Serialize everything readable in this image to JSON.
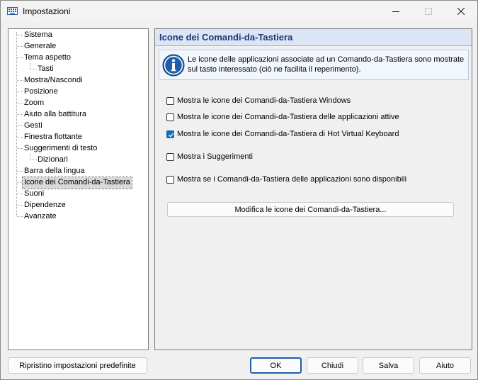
{
  "window": {
    "title": "Impostazioni",
    "icon": "keyboard-icon"
  },
  "tree": {
    "items": [
      {
        "label": "Sistema"
      },
      {
        "label": "Generale"
      },
      {
        "label": "Tema aspetto"
      },
      {
        "label": "Tasti"
      },
      {
        "label": "Mostra/Nascondi"
      },
      {
        "label": "Posizione"
      },
      {
        "label": "Zoom"
      },
      {
        "label": "Aiuto alla battitura"
      },
      {
        "label": "Gesti"
      },
      {
        "label": "Finestra flottante"
      },
      {
        "label": "Suggerimenti di testo"
      },
      {
        "label": "Dizionari"
      },
      {
        "label": "Barra della lingua"
      },
      {
        "label": "Icone dei Comandi-da-Tastiera"
      },
      {
        "label": "Suoni"
      },
      {
        "label": "Dipendenze"
      },
      {
        "label": "Avanzate"
      }
    ],
    "selected": "Icone dei Comandi-da-Tastiera"
  },
  "content": {
    "title": "Icone dei Comandi-da-Tastiera",
    "info": "Le icone delle applicazioni associate ad un Comando-da-Tastiera sono mostrate sul tasto interessato (ciò ne facilita il reperimento).",
    "options": [
      {
        "label": "Mostra le icone dei Comandi-da-Tastiera Windows",
        "checked": false
      },
      {
        "label": "Mostra le icone dei Comandi-da-Tastiera delle applicazioni attive",
        "checked": false
      },
      {
        "label": "Mostra le icone dei Comandi-da-Tastiera di Hot Virtual Keyboard",
        "checked": true
      },
      {
        "label": "Mostra i Suggerimenti",
        "checked": false
      },
      {
        "label": "Mostra se i Comandi-da-Tastiera delle applicazioni sono disponibili",
        "checked": false
      }
    ],
    "edit_button": "Modifica le icone dei Comandi-da-Tastiera..."
  },
  "buttons": {
    "reset": "Ripristino impostazioni predefinite",
    "ok": "OK",
    "close": "Chiudi",
    "save": "Salva",
    "help": "Aiuto"
  },
  "colors": {
    "accent": "#0f6cbd",
    "header_bg": "#dbe5f5",
    "header_text": "#1e3a73"
  }
}
